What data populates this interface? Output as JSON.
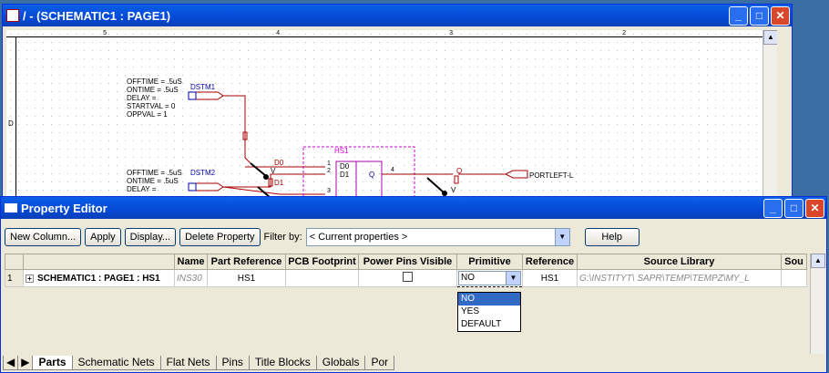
{
  "schematic_window": {
    "title": "/ - (SCHEMATIC1 : PAGE1)",
    "ruler_labels": [
      "5",
      "4",
      "3",
      "2"
    ],
    "side_label": "D",
    "dstm1": {
      "name": "DSTM1",
      "lines": "OFFTIME = .5uS\nONTIME = .5uS\nDELAY =\nSTARTVAL = 0\nOPPVAL = 1"
    },
    "dstm2": {
      "name": "DSTM2",
      "lines": "OFFTIME = .5uS\nONTIME = .5uS\nDELAY ="
    },
    "part_name": "HS1",
    "nets": {
      "d0": "D0",
      "d1": "D1",
      "q": "Q"
    },
    "pins": {
      "p1": "1",
      "p2": "2",
      "p3": "3",
      "p4": "4",
      "in_d0": "D0",
      "in_d1": "D1",
      "out_q": "Q"
    },
    "v1": "V",
    "v2": "V",
    "portleft": "PORTLEFT-L"
  },
  "property_editor": {
    "title": "Property Editor",
    "buttons": {
      "new_column": "New Column...",
      "apply": "Apply",
      "display": "Display...",
      "delete_property": "Delete Property",
      "help": "Help"
    },
    "filter_label": "Filter by:",
    "filter_value": "< Current properties >",
    "columns": [
      "",
      "Name",
      "Part Reference",
      "PCB Footprint",
      "Power Pins Visible",
      "Primitive",
      "Reference",
      "Source Library",
      "Sou"
    ],
    "row": {
      "index": "1",
      "expand": "+",
      "label": "SCHEMATIC1 : PAGE1 : HS1",
      "name": "INS30",
      "part_reference": "HS1",
      "pcb_footprint": "",
      "primitive": "NO",
      "reference": "HS1",
      "source_library": "G:\\INSTITYT\\ SAPR\\TEMP\\TEMPZ\\MY_L"
    },
    "primitive_options": [
      "NO",
      "YES",
      "DEFAULT"
    ],
    "tabs": [
      "Parts",
      "Schematic Nets",
      "Flat Nets",
      "Pins",
      "Title Blocks",
      "Globals",
      "Por"
    ]
  }
}
